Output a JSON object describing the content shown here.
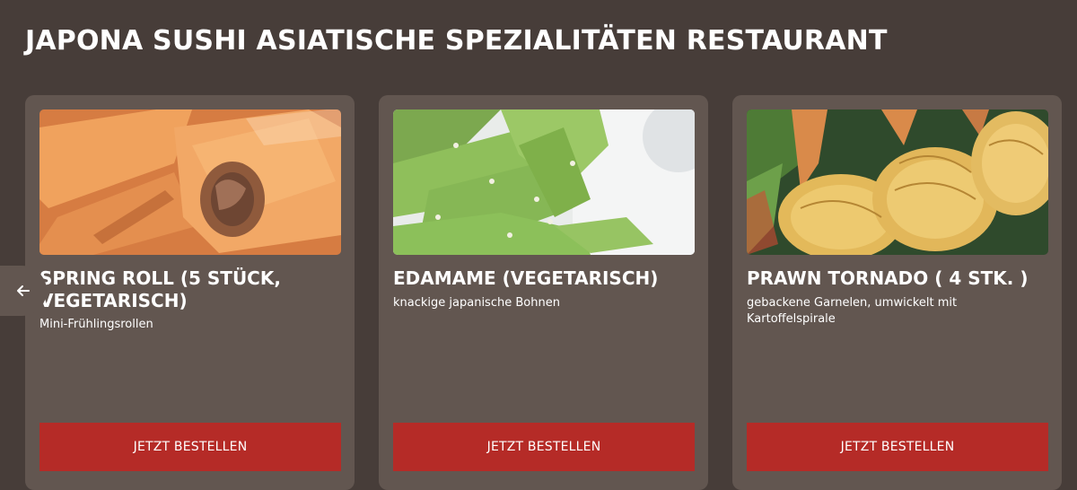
{
  "header": {
    "title": "JAPONA SUSHI ASIATISCHE SPEZIALITÄTEN RESTAURANT"
  },
  "carousel": {
    "prev_icon": "arrow-left-icon",
    "items": [
      {
        "title": "SPRING ROLL (5 STÜCK, VEGETARISCH)",
        "description": "Mini-Frühlingsrollen",
        "button_label": "JETZT BESTELLEN"
      },
      {
        "title": "EDAMAME (VEGETARISCH)",
        "description": "knackige japanische Bohnen",
        "button_label": "JETZT BESTELLEN"
      },
      {
        "title": "PRAWN TORNADO ( 4 STK. )",
        "description": "gebackene Garnelen, umwickelt mit Kartoffelspirale",
        "button_label": "JETZT BESTELLEN"
      }
    ]
  },
  "colors": {
    "background": "#473d39",
    "card": "#625650",
    "button": "#b52b27",
    "text": "#ffffff"
  }
}
